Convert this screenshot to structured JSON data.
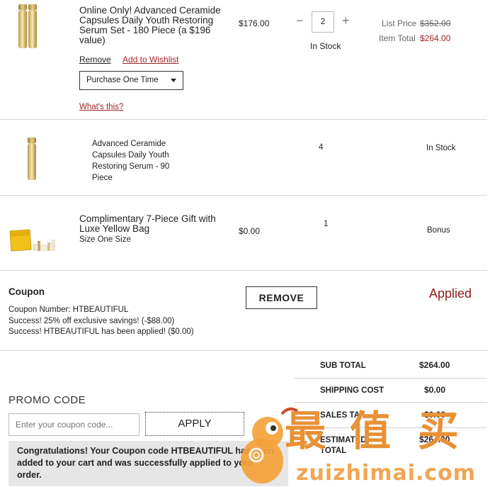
{
  "items": [
    {
      "name": "Online Only! Advanced Ceramide Capsules Daily Youth Restoring Serum Set - 180 Piece (a $196 value)",
      "price": "$176.00",
      "qty": "2",
      "stock": "In Stock",
      "list_price_label": "List Price",
      "list_price": "$352.00",
      "item_total_label": "Item Total",
      "item_total": "$264.00",
      "remove_label": "Remove",
      "wishlist_label": "Add to Wishlist",
      "purchase_option": "Purchase One Time",
      "whats_this": "What's this?"
    },
    {
      "name": "Advanced Ceramide Capsules Daily Youth Restoring Serum - 90 Piece",
      "qty": "4",
      "stock": "In Stock"
    },
    {
      "name": "Complimentary 7-Piece Gift with Luxe Yellow Bag",
      "size": "Size One Size",
      "price": "$0.00",
      "qty": "1",
      "status": "Bonus"
    }
  ],
  "coupon": {
    "title": "Coupon",
    "number_line": "Coupon Number: HTBEAUTIFUL",
    "success1": "Success! 25% off exclusive savings! (-$88.00)",
    "success2": "Success! HTBEAUTIFUL has been applied! ($0.00)",
    "remove_label": "REMOVE",
    "status": "Applied"
  },
  "summary": {
    "subtotal_label": "SUB TOTAL",
    "subtotal": "$264.00",
    "shipping_label": "SHIPPING COST",
    "shipping": "$0.00",
    "tax_label": "SALES TAX",
    "tax": "$0.00",
    "estimated_label": "ESTIMATED",
    "total_label": "TOTAL",
    "estimated": "$264.00"
  },
  "promo": {
    "title": "PROMO CODE",
    "placeholder": "Enter your coupon code...",
    "apply_label": "APPLY",
    "congrats": "Congratulations! Your Coupon code HTBEAUTIFUL has been added to your cart and was successfully applied to your order."
  },
  "watermark": {
    "cn": [
      "最",
      "值",
      "买"
    ],
    "url": "zuizhimai.com"
  },
  "colors": {
    "accent_red": "#a12525",
    "applied_red": "#8a1d1d",
    "watermark_orange": "#e89136"
  }
}
